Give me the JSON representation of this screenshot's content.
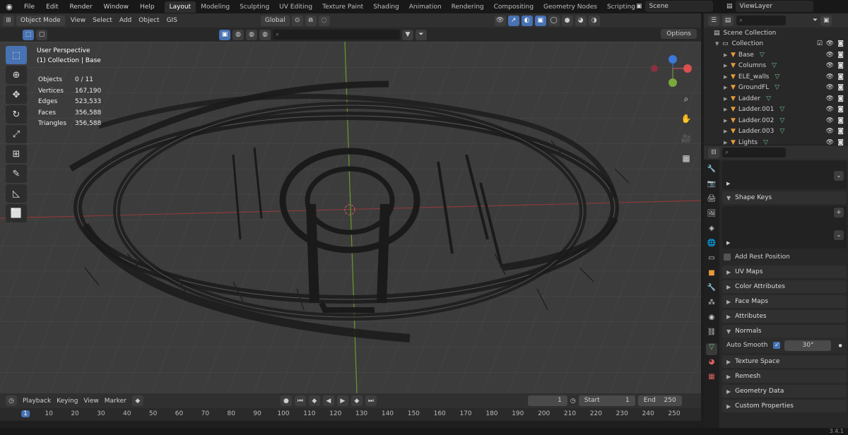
{
  "topbar": {
    "menus": [
      "File",
      "Edit",
      "Render",
      "Window",
      "Help"
    ],
    "workspaces": [
      "Layout",
      "Modeling",
      "Sculpting",
      "UV Editing",
      "Texture Paint",
      "Shading",
      "Animation",
      "Rendering",
      "Compositing",
      "Geometry Nodes",
      "Scripting"
    ],
    "active_workspace": "Layout",
    "scene": "Scene",
    "view_layer": "ViewLayer"
  },
  "viewport_header": {
    "mode": "Object Mode",
    "menus": [
      "View",
      "Select",
      "Add",
      "Object",
      "GIS"
    ],
    "orientation": "Global",
    "options": "Options"
  },
  "viewport": {
    "view_name": "User Perspective",
    "collection_path": "(1) Collection | Base",
    "stats": [
      {
        "label": "Objects",
        "value": "0 / 11"
      },
      {
        "label": "Vertices",
        "value": "167,190"
      },
      {
        "label": "Edges",
        "value": "523,533"
      },
      {
        "label": "Faces",
        "value": "356,588"
      },
      {
        "label": "Triangles",
        "value": "356,588"
      }
    ]
  },
  "outliner": {
    "root": "Scene Collection",
    "collection": "Collection",
    "items": [
      "Base",
      "Columns",
      "ELE_walls",
      "GroundFL",
      "Ladder",
      "Ladder.001",
      "Ladder.002",
      "Ladder.003",
      "Lights"
    ]
  },
  "properties": {
    "panels_top": [
      "Shape Keys"
    ],
    "add_rest_position": "Add Rest Position",
    "panels": [
      "UV Maps",
      "Color Attributes",
      "Face Maps",
      "Attributes",
      "Normals"
    ],
    "auto_smooth_label": "Auto Smooth",
    "auto_smooth_angle": "30°",
    "panels_after": [
      "Texture Space",
      "Remesh",
      "Geometry Data",
      "Custom Properties"
    ]
  },
  "timeline": {
    "menus": [
      "Playback",
      "Keying",
      "View",
      "Marker"
    ],
    "current_frame": "1",
    "start_label": "Start",
    "start": "1",
    "end_label": "End",
    "end": "250",
    "ticks": [
      "1",
      "10",
      "20",
      "30",
      "40",
      "50",
      "60",
      "70",
      "80",
      "90",
      "100",
      "110",
      "120",
      "130",
      "140",
      "150",
      "160",
      "170",
      "180",
      "190",
      "200",
      "210",
      "220",
      "230",
      "240",
      "250"
    ]
  },
  "statusbar": {
    "version": "3.4.1"
  }
}
